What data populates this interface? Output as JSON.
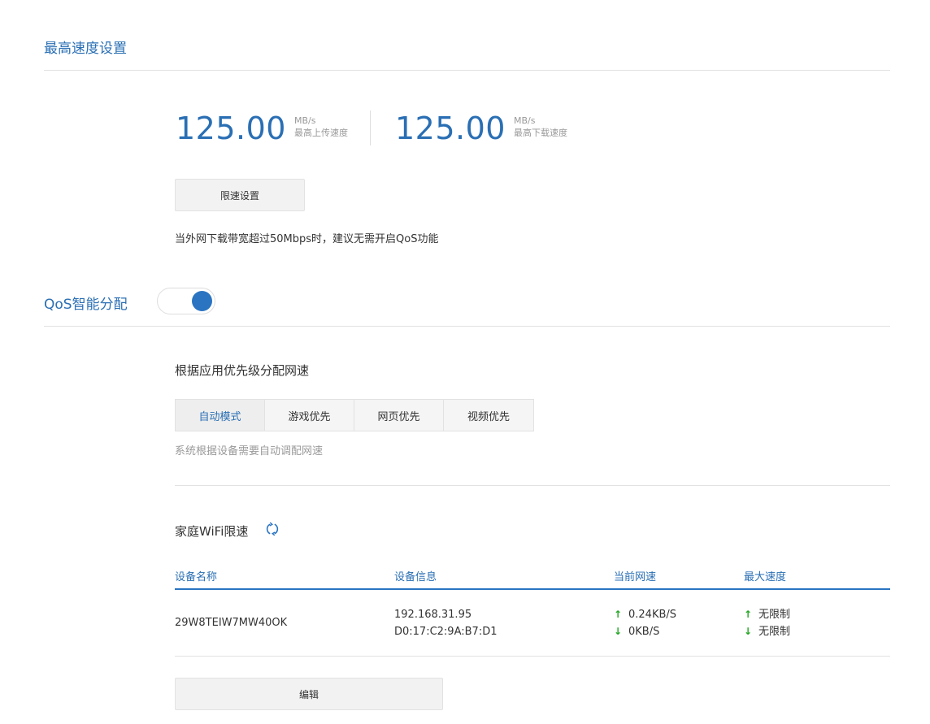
{
  "max_speed_section": {
    "title": "最高速度设置",
    "upload": {
      "value": "125.00",
      "unit": "MB/s",
      "label": "最高上传速度"
    },
    "download": {
      "value": "125.00",
      "unit": "MB/s",
      "label": "最高下载速度"
    },
    "limit_button": "限速设置",
    "note": "当外网下载带宽超过50Mbps时，建议无需开启QoS功能"
  },
  "qos_section": {
    "title": "QoS智能分配",
    "enabled": true,
    "subtitle": "根据应用优先级分配网速",
    "modes": [
      {
        "label": "自动模式",
        "active": true
      },
      {
        "label": "游戏优先",
        "active": false
      },
      {
        "label": "网页优先",
        "active": false
      },
      {
        "label": "视频优先",
        "active": false
      }
    ],
    "mode_hint": "系统根据设备需要自动调配网速"
  },
  "wifi_limit": {
    "title": "家庭WiFi限速",
    "refresh_icon": "refresh-icon",
    "columns": [
      "设备名称",
      "设备信息",
      "当前网速",
      "最大速度"
    ],
    "rows": [
      {
        "name": "29W8TEIW7MW40OK",
        "ip": "192.168.31.95",
        "mac": "D0:17:C2:9A:B7:D1",
        "up_speed": "0.24KB/S",
        "down_speed": "0KB/S",
        "max_up": "无限制",
        "max_down": "无限制"
      }
    ],
    "edit_button": "编辑"
  },
  "colors": {
    "accent": "#2a6fb4",
    "arrow": "#23a523"
  }
}
